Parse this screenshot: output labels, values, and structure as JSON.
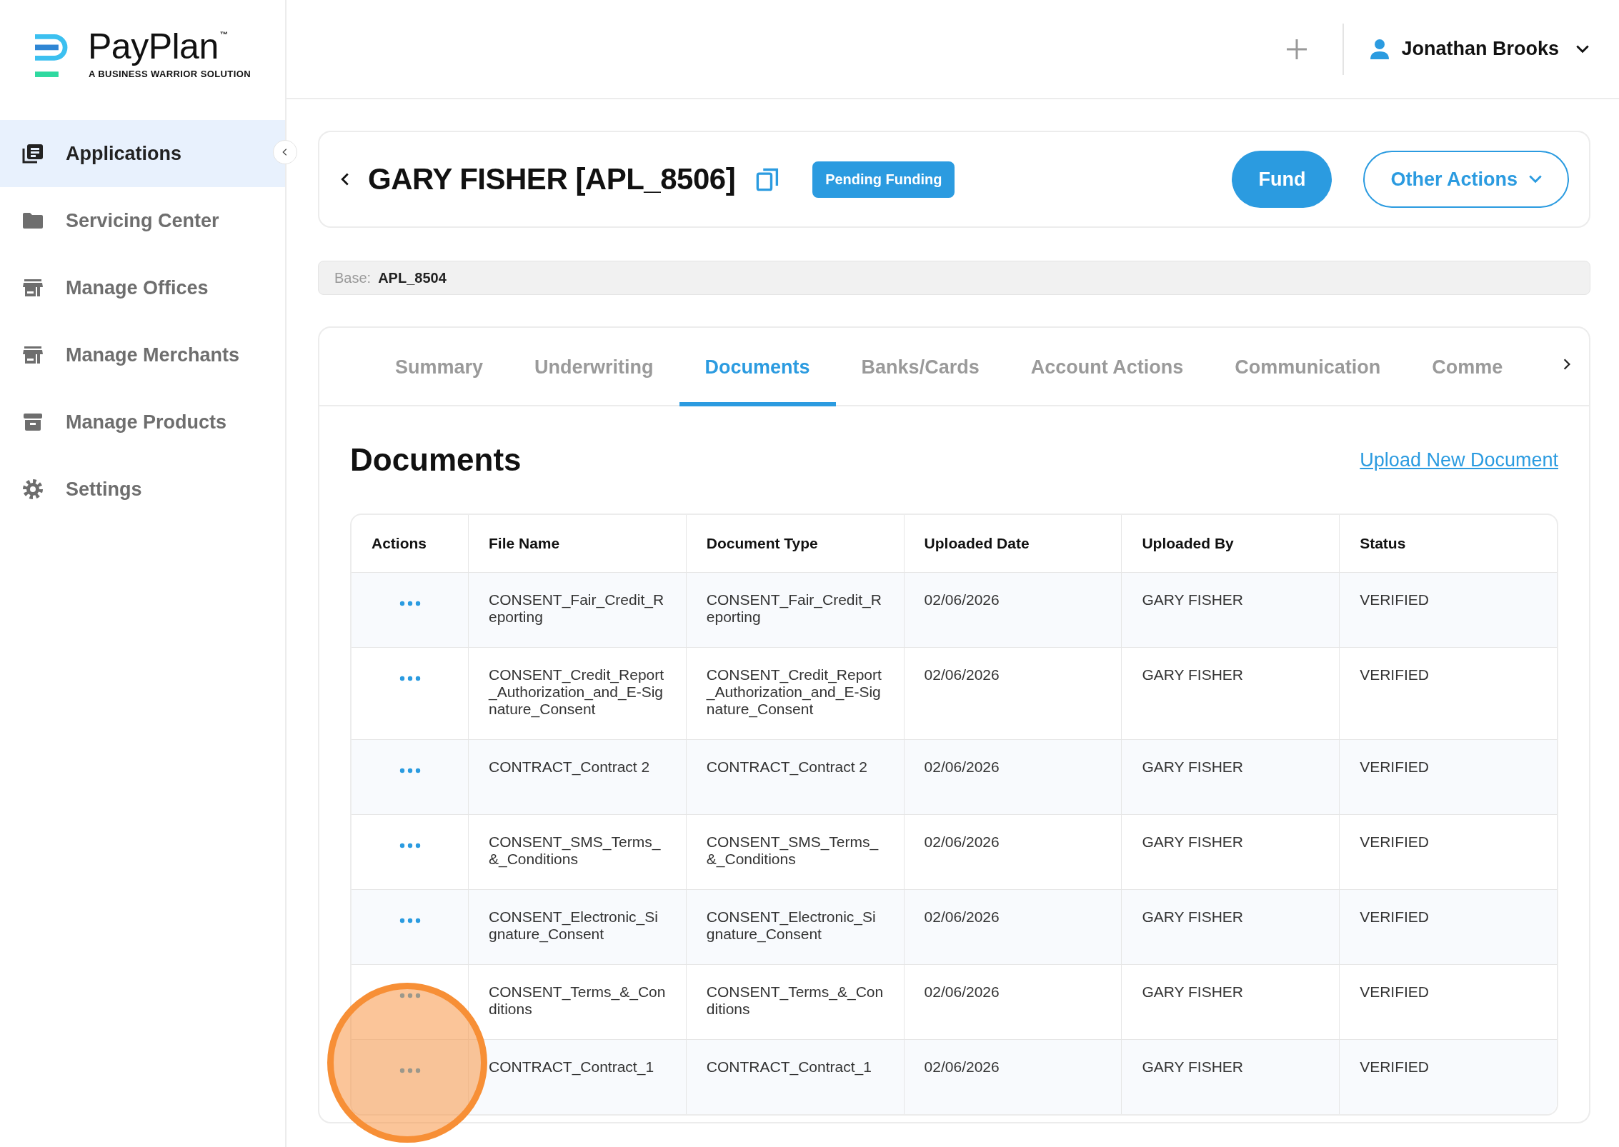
{
  "logo": {
    "name": "PayPlan",
    "trademark": "™",
    "tagline": "A BUSINESS WARRIOR SOLUTION"
  },
  "sidebar": {
    "items": [
      {
        "label": "Applications",
        "kind": "applications",
        "selected": true
      },
      {
        "label": "Servicing Center",
        "kind": "folder",
        "selected": false
      },
      {
        "label": "Manage Offices",
        "kind": "store",
        "selected": false
      },
      {
        "label": "Manage Merchants",
        "kind": "store",
        "selected": false
      },
      {
        "label": "Manage Products",
        "kind": "archive",
        "selected": false
      },
      {
        "label": "Settings",
        "kind": "gear",
        "selected": false
      }
    ]
  },
  "topbar": {
    "user": "Jonathan Brooks"
  },
  "application": {
    "title": "GARY FISHER [APL_8506]",
    "status": "Pending Funding",
    "actions": [
      "Fund",
      "Other Actions"
    ],
    "base_label": "Base:",
    "base_value": "APL_8504"
  },
  "tabs": [
    {
      "label": "Summary",
      "selected": false
    },
    {
      "label": "Underwriting",
      "selected": false
    },
    {
      "label": "Documents",
      "selected": true
    },
    {
      "label": "Banks/Cards",
      "selected": false
    },
    {
      "label": "Account Actions",
      "selected": false
    },
    {
      "label": "Communication",
      "selected": false
    },
    {
      "label": "Comme",
      "selected": false
    }
  ],
  "documents": {
    "title": "Documents",
    "upload_link": "Upload New Document",
    "table": {
      "columns": [
        "Actions",
        "File Name",
        "Document Type",
        "Uploaded Date",
        "Uploaded By",
        "Status"
      ],
      "rows": [
        {
          "file_name": "CONSENT_Fair_Credit_Reporting",
          "document_type": "CONSENT_Fair_Credit_Reporting",
          "uploaded_date": "02/06/2026",
          "uploaded_by": "GARY FISHER",
          "status": "VERIFIED"
        },
        {
          "file_name": "CONSENT_Credit_Report_Authorization_and_E-Signature_Consent",
          "document_type": "CONSENT_Credit_Report_Authorization_and_E-Signature_Consent",
          "uploaded_date": "02/06/2026",
          "uploaded_by": "GARY FISHER",
          "status": "VERIFIED"
        },
        {
          "file_name": "CONTRACT_Contract 2",
          "document_type": "CONTRACT_Contract 2",
          "uploaded_date": "02/06/2026",
          "uploaded_by": "GARY FISHER",
          "status": "VERIFIED"
        },
        {
          "file_name": "CONSENT_SMS_Terms_&_Conditions",
          "document_type": "CONSENT_SMS_Terms_&_Conditions",
          "uploaded_date": "02/06/2026",
          "uploaded_by": "GARY FISHER",
          "status": "VERIFIED"
        },
        {
          "file_name": "CONSENT_Electronic_Signature_Consent",
          "document_type": "CONSENT_Electronic_Signature_Consent",
          "uploaded_date": "02/06/2026",
          "uploaded_by": "GARY FISHER",
          "status": "VERIFIED"
        },
        {
          "file_name": "CONSENT_Terms_&_Conditions",
          "document_type": "CONSENT_Terms_&_Conditions",
          "uploaded_date": "02/06/2026",
          "uploaded_by": "GARY FISHER",
          "status": "VERIFIED"
        },
        {
          "file_name": "CONTRACT_Contract_1",
          "document_type": "CONTRACT_Contract_1",
          "uploaded_date": "02/06/2026",
          "uploaded_by": "GARY FISHER",
          "status": "VERIFIED"
        }
      ]
    }
  }
}
